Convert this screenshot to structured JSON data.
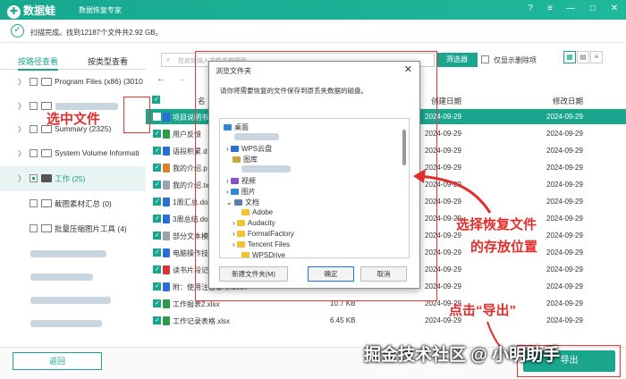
{
  "app": {
    "name": "数据蛙",
    "subtitle": "数据恢复专家"
  },
  "scan": {
    "text": "扫描完成。找到12187个文件共2.92 GB。"
  },
  "left_tabs": [
    "按路径查看",
    "按类型查看"
  ],
  "tree": [
    {
      "label": "Program Files (x86) (3010"
    },
    {
      "label": "Summary (2325)"
    },
    {
      "label": "System Volume Informati"
    },
    {
      "label": "工作 (25)"
    },
    {
      "label": "截图素材汇总 (0)"
    },
    {
      "label": "批量压缩图片工具 (4)"
    }
  ],
  "toolbar": {
    "search_placeholder": "在此处输入文件名称搜索",
    "filter": "筛选器",
    "delete_only": "仅显示删除项"
  },
  "table": {
    "headers": {
      "name": "名",
      "created": "创建日期",
      "modified": "修改日期"
    },
    "rows": [
      {
        "name": "项目说明书",
        "size": "",
        "created": "2024-09-29",
        "modified": "2024-09-29",
        "color": "#2b6fd6"
      },
      {
        "name": "用户反馈",
        "size": "",
        "created": "2024-09-29",
        "modified": "2024-09-29",
        "color": "#2e9b49"
      },
      {
        "name": "语段积累.d",
        "size": "",
        "created": "2024-09-29",
        "modified": "2024-09-29",
        "color": "#2b6fd6"
      },
      {
        "name": "我的介绍.p",
        "size": "",
        "created": "2024-09-29",
        "modified": "2024-09-29",
        "color": "#e0812b"
      },
      {
        "name": "我的介绍.tx",
        "size": "",
        "created": "2024-09-29",
        "modified": "2024-09-29",
        "color": "#9aa4b1"
      },
      {
        "name": "1周汇总.doc",
        "size": "",
        "created": "2024-09-29",
        "modified": "2024-09-29",
        "color": "#2b6fd6"
      },
      {
        "name": "3周总结.do",
        "size": "",
        "created": "2024-09-29",
        "modified": "2024-09-29",
        "color": "#2b6fd6"
      },
      {
        "name": "部分文本模",
        "size": "",
        "created": "2024-09-29",
        "modified": "2024-09-29",
        "color": "#9aa4b1"
      },
      {
        "name": "电脑操作技",
        "size": "",
        "created": "2024-09-29",
        "modified": "2024-09-29",
        "color": "#2b6fd6"
      },
      {
        "name": "读书片段记",
        "size": "",
        "created": "2024-09-29",
        "modified": "2024-09-29",
        "color": "#d8343a"
      },
      {
        "name": "附：使用注意事项.docx",
        "size": "1.52 MB",
        "created": "2024-09-29",
        "modified": "2024-09-29",
        "color": "#2b6fd6"
      },
      {
        "name": "工作报表2.xlsx",
        "size": "10.7 KB",
        "created": "2024-09-29",
        "modified": "2024-09-29",
        "color": "#2e9b49"
      },
      {
        "name": "工作记录表格.xlsx",
        "size": "6.45 KB",
        "created": "2024-09-29",
        "modified": "2024-09-29",
        "color": "#2e9b49"
      }
    ]
  },
  "dialog": {
    "title": "浏览文件夹",
    "prompt": "请你将需要恢复的文件保存到原丢失数据的磁盘。",
    "tree": [
      "桌面",
      "WPS云盘",
      "图库",
      "视频",
      "图片",
      "文档",
      "Adobe",
      "Audacity",
      "FormatFactory",
      "Tencent Files",
      "WPSDrive"
    ],
    "new_folder": "新建文件夹(M)",
    "ok": "确定",
    "cancel": "取消"
  },
  "annotations": {
    "select_file": "选中文件",
    "choose_location_1": "选择恢复文件",
    "choose_location_2": "的存放位置",
    "click_export": "点击“导出”"
  },
  "buttons": {
    "back": "返回",
    "export": "导出"
  },
  "watermark": "掘金技术社区 @ 小明助手",
  "colors": {
    "accent": "#1aa58c",
    "annotation": "#e32d2d"
  }
}
